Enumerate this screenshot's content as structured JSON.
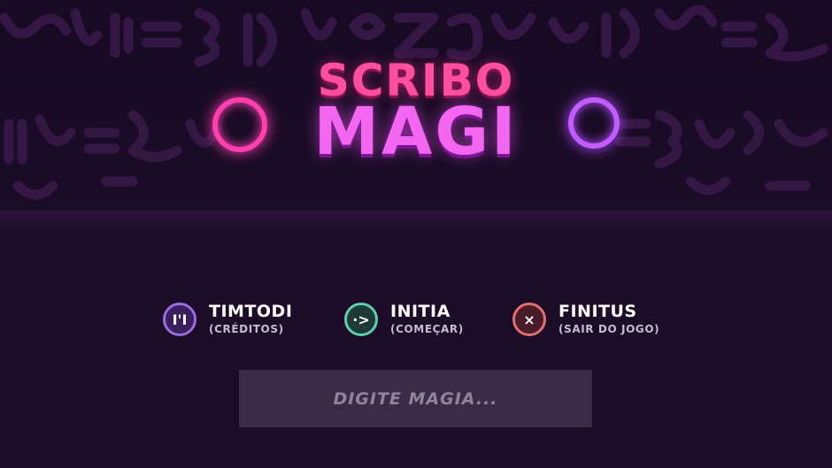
{
  "title": {
    "line1": "SCRIBO",
    "line2": "MAGI"
  },
  "menu": [
    {
      "icon": "pause-icon",
      "glyph": "I'I",
      "label": "TIMTODI",
      "sub": "(CRÉDITOS)"
    },
    {
      "icon": "arrow-right-icon",
      "glyph": "·>",
      "label": "INITIA",
      "sub": "(COMEÇAR)"
    },
    {
      "icon": "close-icon",
      "glyph": "×",
      "label": "FINITUS",
      "sub": "(SAIR DO JOGO)"
    }
  ],
  "spell_input": {
    "placeholder": "DIGITE MAGIA...",
    "value": ""
  },
  "colors": {
    "background": "#1a0b26",
    "title_top": "#ff4f9e",
    "title_bottom": "#f266f0",
    "ring_left": "#ff3fae",
    "ring_right": "#c25cff",
    "credits_accent": "#9b6be0",
    "start_accent": "#5fcfae",
    "quit_accent": "#e07070",
    "input_bg": "#3a2c48"
  }
}
